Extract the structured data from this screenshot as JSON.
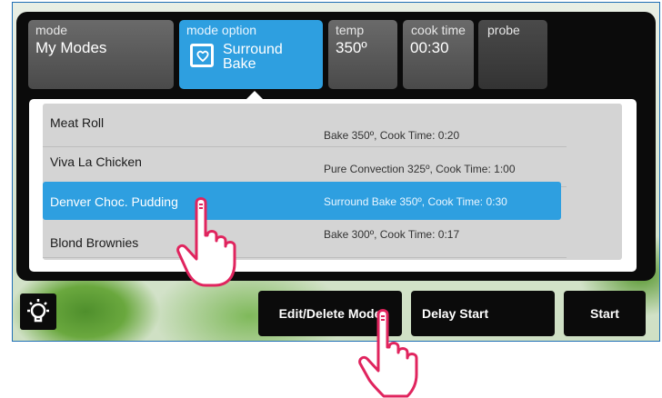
{
  "tabs": [
    {
      "label": "mode",
      "value": "My Modes"
    },
    {
      "label": "mode option",
      "value": "Surround Bake"
    },
    {
      "label": "temp",
      "value": "350º"
    },
    {
      "label": "cook time",
      "value": "00:30"
    },
    {
      "label": "probe",
      "value": ""
    }
  ],
  "recipes": [
    {
      "name": "Meat Roll",
      "detail": "Bake 350º, Cook Time: 0:20",
      "selected": false
    },
    {
      "name": "Viva La Chicken",
      "detail": "Pure Convection 325º, Cook Time: 1:00",
      "selected": false
    },
    {
      "name": "Denver Choc. Pudding",
      "detail": "Surround Bake 350º, Cook Time: 0:30",
      "selected": true
    },
    {
      "name": "Blond Brownies",
      "detail": "Bake 300º, Cook Time: 0:17",
      "selected": false
    }
  ],
  "bottom_bar": {
    "light_icon": "light-bulb-icon",
    "edit_delete_label": "Edit/Delete Mode",
    "delay_start_label": "Delay Start",
    "start_label": "Start"
  },
  "annotations": {
    "hand_icon": "pointing-hand-icon",
    "hand_color": "#e0245e"
  },
  "colors": {
    "accent": "#2e9fe0",
    "panel": "#0b0b0b"
  }
}
